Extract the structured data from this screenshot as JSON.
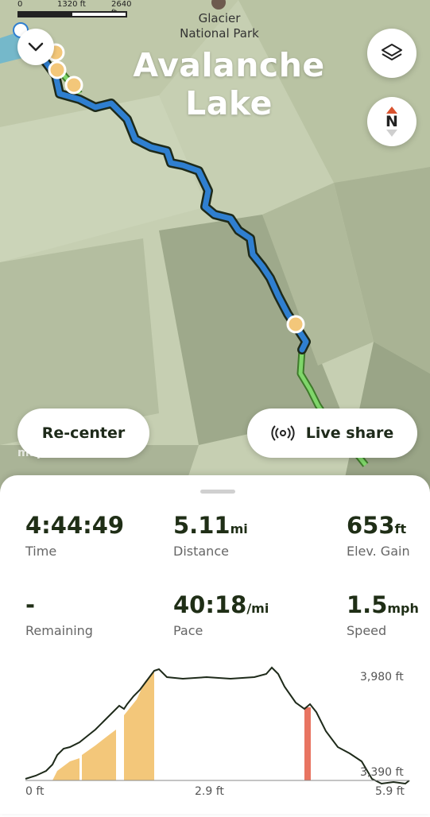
{
  "map": {
    "scale_labels": [
      "0",
      "1320 ft",
      "2640 ft"
    ],
    "poi_label_line1": "Glacier",
    "poi_label_line2": "National Park",
    "title": "Avalanche Lake",
    "route_color": "#2f7fd0",
    "planned_route_color": "#7fd66a",
    "waypoint_color": "#f3c77a",
    "attribution": "mapbox"
  },
  "buttons": {
    "recenter": "Re-center",
    "live_share": "Live share",
    "compass": "N"
  },
  "stats": {
    "time": {
      "value": "4:44:49",
      "unit": "",
      "label": "Time"
    },
    "distance": {
      "value": "5.11",
      "unit": "mi",
      "label": "Distance"
    },
    "elev_gain": {
      "value": "653",
      "unit": "ft",
      "label": "Elev. Gain"
    },
    "remaining": {
      "value": "-",
      "unit": "",
      "label": "Remaining"
    },
    "pace": {
      "value": "40:18",
      "unit": "/mi",
      "label": "Pace"
    },
    "speed": {
      "value": "1.5",
      "unit": "mph",
      "label": "Speed"
    }
  },
  "elevation_chart": {
    "y_top_label": "3,980 ft",
    "y_bottom_label": "3,390 ft",
    "x_labels": [
      "0 ft",
      "2.9 ft",
      "5.9 ft"
    ],
    "fill_color": "#f3c77a",
    "marker_color": "#e87461"
  }
}
